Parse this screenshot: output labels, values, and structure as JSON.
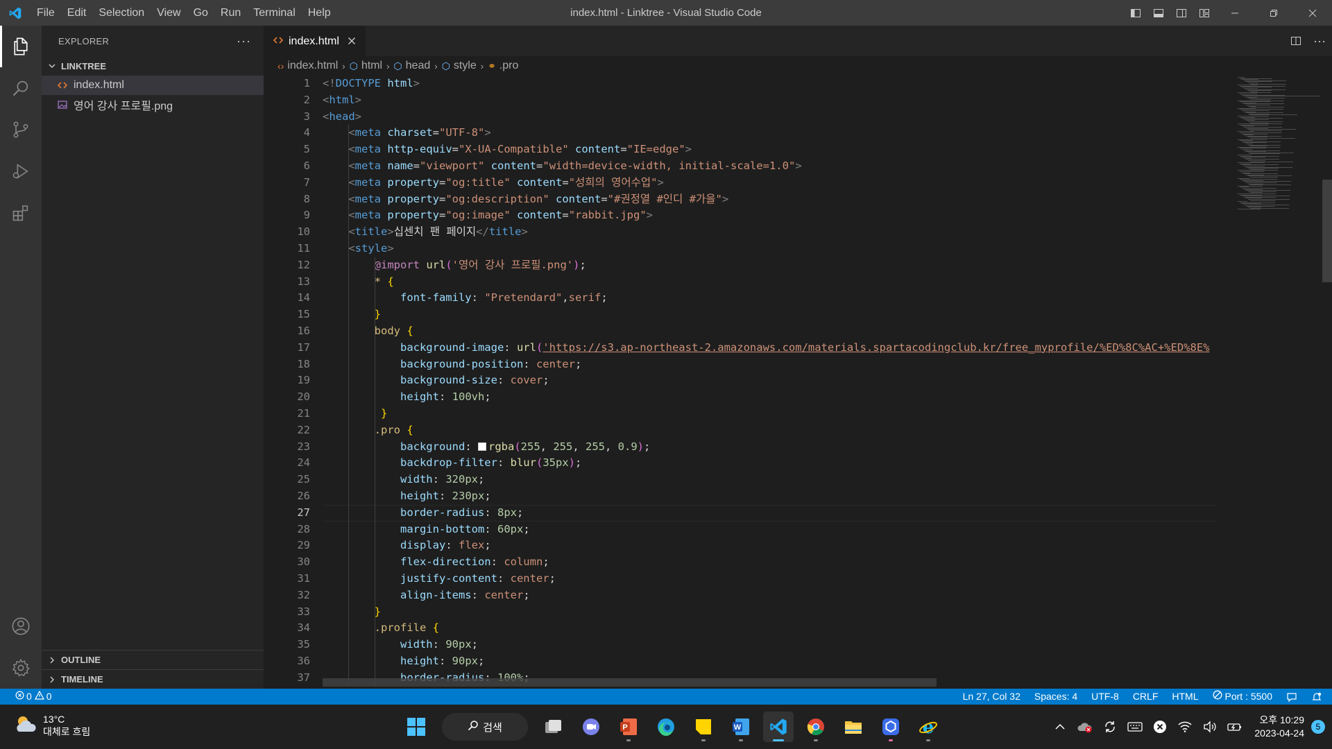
{
  "window": {
    "title": "index.html - Linktree - Visual Studio Code",
    "menu": [
      "File",
      "Edit",
      "Selection",
      "View",
      "Go",
      "Run",
      "Terminal",
      "Help"
    ]
  },
  "sidebar": {
    "title": "EXPLORER",
    "folder": "LINKTREE",
    "files": [
      {
        "name": "index.html",
        "icon": "html-file-icon"
      },
      {
        "name": "영어 강사 프로필.png",
        "icon": "image-file-icon"
      }
    ],
    "outline": "OUTLINE",
    "timeline": "TIMELINE"
  },
  "editor": {
    "tab_label": "index.html",
    "breadcrumb": [
      "index.html",
      "html",
      "head",
      "style",
      ".pro"
    ],
    "current_line": 27,
    "line_numbers": [
      1,
      2,
      3,
      4,
      5,
      6,
      7,
      8,
      9,
      10,
      11,
      12,
      13,
      14,
      15,
      16,
      17,
      18,
      19,
      20,
      21,
      22,
      23,
      24,
      25,
      26,
      27,
      28,
      29,
      30,
      31,
      32,
      33,
      34,
      35,
      36,
      37
    ],
    "lines": [
      {
        "indent": 0,
        "tokens": [
          [
            "t-tag",
            "<!"
          ],
          [
            "t-name",
            "DOCTYPE "
          ],
          [
            "t-attr",
            "html"
          ],
          [
            "t-tag",
            ">"
          ]
        ]
      },
      {
        "indent": 0,
        "tokens": [
          [
            "t-tag",
            "<"
          ],
          [
            "t-name",
            "html"
          ],
          [
            "t-tag",
            ">"
          ]
        ]
      },
      {
        "indent": 0,
        "tokens": [
          [
            "t-tag",
            "<"
          ],
          [
            "t-name",
            "head"
          ],
          [
            "t-tag",
            ">"
          ]
        ]
      },
      {
        "indent": 1,
        "tokens": [
          [
            "t-tag",
            "<"
          ],
          [
            "t-name",
            "meta "
          ],
          [
            "t-attr",
            "charset"
          ],
          [
            "t-punct",
            "="
          ],
          [
            "t-str",
            "\"UTF-8\""
          ],
          [
            "t-tag",
            ">"
          ]
        ]
      },
      {
        "indent": 1,
        "tokens": [
          [
            "t-tag",
            "<"
          ],
          [
            "t-name",
            "meta "
          ],
          [
            "t-attr",
            "http-equiv"
          ],
          [
            "t-punct",
            "="
          ],
          [
            "t-str",
            "\"X-UA-Compatible\""
          ],
          [
            "t-punct",
            " "
          ],
          [
            "t-attr",
            "content"
          ],
          [
            "t-punct",
            "="
          ],
          [
            "t-str",
            "\"IE=edge\""
          ],
          [
            "t-tag",
            ">"
          ]
        ]
      },
      {
        "indent": 1,
        "tokens": [
          [
            "t-tag",
            "<"
          ],
          [
            "t-name",
            "meta "
          ],
          [
            "t-attr",
            "name"
          ],
          [
            "t-punct",
            "="
          ],
          [
            "t-str",
            "\"viewport\""
          ],
          [
            "t-punct",
            " "
          ],
          [
            "t-attr",
            "content"
          ],
          [
            "t-punct",
            "="
          ],
          [
            "t-str",
            "\"width=device-width, initial-scale=1.0\""
          ],
          [
            "t-tag",
            ">"
          ]
        ]
      },
      {
        "indent": 1,
        "tokens": [
          [
            "t-tag",
            "<"
          ],
          [
            "t-name",
            "meta "
          ],
          [
            "t-attr",
            "property"
          ],
          [
            "t-punct",
            "="
          ],
          [
            "t-str",
            "\"og:title\""
          ],
          [
            "t-punct",
            " "
          ],
          [
            "t-attr",
            "content"
          ],
          [
            "t-punct",
            "="
          ],
          [
            "t-str",
            "\"성희의 영어수업\""
          ],
          [
            "t-tag",
            ">"
          ]
        ]
      },
      {
        "indent": 1,
        "tokens": [
          [
            "t-tag",
            "<"
          ],
          [
            "t-name",
            "meta "
          ],
          [
            "t-attr",
            "property"
          ],
          [
            "t-punct",
            "="
          ],
          [
            "t-str",
            "\"og:description\""
          ],
          [
            "t-punct",
            " "
          ],
          [
            "t-attr",
            "content"
          ],
          [
            "t-punct",
            "="
          ],
          [
            "t-str",
            "\"#권정열 #인디 #가을\""
          ],
          [
            "t-tag",
            ">"
          ]
        ]
      },
      {
        "indent": 1,
        "tokens": [
          [
            "t-tag",
            "<"
          ],
          [
            "t-name",
            "meta "
          ],
          [
            "t-attr",
            "property"
          ],
          [
            "t-punct",
            "="
          ],
          [
            "t-str",
            "\"og:image\""
          ],
          [
            "t-punct",
            " "
          ],
          [
            "t-attr",
            "content"
          ],
          [
            "t-punct",
            "="
          ],
          [
            "t-str",
            "\"rabbit.jpg\""
          ],
          [
            "t-tag",
            ">"
          ]
        ]
      },
      {
        "indent": 1,
        "tokens": [
          [
            "t-tag",
            "<"
          ],
          [
            "t-name",
            "title"
          ],
          [
            "t-tag",
            ">"
          ],
          [
            "t-text",
            "십센치 팬 페이지"
          ],
          [
            "t-tag",
            "</"
          ],
          [
            "t-name",
            "title"
          ],
          [
            "t-tag",
            ">"
          ]
        ]
      },
      {
        "indent": 1,
        "tokens": [
          [
            "t-tag",
            "<"
          ],
          [
            "t-name",
            "style"
          ],
          [
            "t-tag",
            ">"
          ]
        ]
      },
      {
        "indent": 2,
        "tokens": [
          [
            "t-at",
            "@import "
          ],
          [
            "t-fn",
            "url"
          ],
          [
            "t-br2",
            "("
          ],
          [
            "t-str",
            "'영어 강사 프로필.png'"
          ],
          [
            "t-br2",
            ")"
          ],
          [
            "t-punct",
            ";"
          ]
        ]
      },
      {
        "indent": 2,
        "tokens": [
          [
            "t-sel",
            "* "
          ],
          [
            "t-br1",
            "{"
          ]
        ]
      },
      {
        "indent": 3,
        "tokens": [
          [
            "t-prop",
            "font-family"
          ],
          [
            "t-punct",
            ": "
          ],
          [
            "t-val",
            "\"Pretendard\""
          ],
          [
            "t-punct",
            ","
          ],
          [
            "t-val",
            "serif"
          ],
          [
            "t-punct",
            ";"
          ]
        ]
      },
      {
        "indent": 2,
        "tokens": [
          [
            "t-br1",
            "}"
          ]
        ]
      },
      {
        "indent": 2,
        "tokens": [
          [
            "t-sel",
            "body "
          ],
          [
            "t-br1",
            "{"
          ]
        ]
      },
      {
        "indent": 3,
        "tokens": [
          [
            "t-prop",
            "background-image"
          ],
          [
            "t-punct",
            ": "
          ],
          [
            "t-fn",
            "url"
          ],
          [
            "t-br2",
            "("
          ],
          [
            "t-url",
            "'https://s3.ap-northeast-2.amazonaws.com/materials.spartacodingclub.kr/free_myprofile/%ED%8C%AC+%ED%8E%"
          ]
        ]
      },
      {
        "indent": 3,
        "tokens": [
          [
            "t-prop",
            "background-position"
          ],
          [
            "t-punct",
            ": "
          ],
          [
            "t-val",
            "center"
          ],
          [
            "t-punct",
            ";"
          ]
        ]
      },
      {
        "indent": 3,
        "tokens": [
          [
            "t-prop",
            "background-size"
          ],
          [
            "t-punct",
            ": "
          ],
          [
            "t-val",
            "cover"
          ],
          [
            "t-punct",
            ";"
          ]
        ]
      },
      {
        "indent": 3,
        "tokens": [
          [
            "t-prop",
            "height"
          ],
          [
            "t-punct",
            ": "
          ],
          [
            "t-num",
            "100vh"
          ],
          [
            "t-punct",
            ";"
          ]
        ]
      },
      {
        "indent": 2,
        "tokens": [
          [
            "t-punct",
            " "
          ],
          [
            "t-br1",
            "}"
          ]
        ]
      },
      {
        "indent": 2,
        "tokens": [
          [
            "t-sel",
            ".pro "
          ],
          [
            "t-br1",
            "{"
          ]
        ]
      },
      {
        "indent": 3,
        "swatch": true,
        "tokens": [
          [
            "t-prop",
            "background"
          ],
          [
            "t-punct",
            ": "
          ],
          [
            "t-fn",
            "rgba"
          ],
          [
            "t-br2",
            "("
          ],
          [
            "t-num",
            "255"
          ],
          [
            "t-punct",
            ", "
          ],
          [
            "t-num",
            "255"
          ],
          [
            "t-punct",
            ", "
          ],
          [
            "t-num",
            "255"
          ],
          [
            "t-punct",
            ", "
          ],
          [
            "t-num",
            "0.9"
          ],
          [
            "t-br2",
            ")"
          ],
          [
            "t-punct",
            ";"
          ]
        ]
      },
      {
        "indent": 3,
        "tokens": [
          [
            "t-prop",
            "backdrop-filter"
          ],
          [
            "t-punct",
            ": "
          ],
          [
            "t-fn",
            "blur"
          ],
          [
            "t-br2",
            "("
          ],
          [
            "t-num",
            "35px"
          ],
          [
            "t-br2",
            ")"
          ],
          [
            "t-punct",
            ";"
          ]
        ]
      },
      {
        "indent": 3,
        "tokens": [
          [
            "t-prop",
            "width"
          ],
          [
            "t-punct",
            ": "
          ],
          [
            "t-num",
            "320px"
          ],
          [
            "t-punct",
            ";"
          ]
        ]
      },
      {
        "indent": 3,
        "tokens": [
          [
            "t-prop",
            "height"
          ],
          [
            "t-punct",
            ": "
          ],
          [
            "t-num",
            "230px"
          ],
          [
            "t-punct",
            ";"
          ]
        ]
      },
      {
        "indent": 3,
        "tokens": [
          [
            "t-prop",
            "border-radius"
          ],
          [
            "t-punct",
            ": "
          ],
          [
            "t-num",
            "8px"
          ],
          [
            "t-punct",
            ";"
          ]
        ]
      },
      {
        "indent": 3,
        "tokens": [
          [
            "t-prop",
            "margin-bottom"
          ],
          [
            "t-punct",
            ": "
          ],
          [
            "t-num",
            "60px"
          ],
          [
            "t-punct",
            ";"
          ]
        ]
      },
      {
        "indent": 3,
        "tokens": [
          [
            "t-prop",
            "display"
          ],
          [
            "t-punct",
            ": "
          ],
          [
            "t-val",
            "flex"
          ],
          [
            "t-punct",
            ";"
          ]
        ]
      },
      {
        "indent": 3,
        "tokens": [
          [
            "t-prop",
            "flex-direction"
          ],
          [
            "t-punct",
            ": "
          ],
          [
            "t-val",
            "column"
          ],
          [
            "t-punct",
            ";"
          ]
        ]
      },
      {
        "indent": 3,
        "tokens": [
          [
            "t-prop",
            "justify-content"
          ],
          [
            "t-punct",
            ": "
          ],
          [
            "t-val",
            "center"
          ],
          [
            "t-punct",
            ";"
          ]
        ]
      },
      {
        "indent": 3,
        "tokens": [
          [
            "t-prop",
            "align-items"
          ],
          [
            "t-punct",
            ": "
          ],
          [
            "t-val",
            "center"
          ],
          [
            "t-punct",
            ";"
          ]
        ]
      },
      {
        "indent": 2,
        "tokens": [
          [
            "t-br1",
            "}"
          ]
        ]
      },
      {
        "indent": 2,
        "tokens": [
          [
            "t-sel",
            ".profile "
          ],
          [
            "t-br1",
            "{"
          ]
        ]
      },
      {
        "indent": 3,
        "tokens": [
          [
            "t-prop",
            "width"
          ],
          [
            "t-punct",
            ": "
          ],
          [
            "t-num",
            "90px"
          ],
          [
            "t-punct",
            ";"
          ]
        ]
      },
      {
        "indent": 3,
        "tokens": [
          [
            "t-prop",
            "height"
          ],
          [
            "t-punct",
            ": "
          ],
          [
            "t-num",
            "90px"
          ],
          [
            "t-punct",
            ";"
          ]
        ]
      },
      {
        "indent": 3,
        "tokens": [
          [
            "t-prop",
            "border-radius"
          ],
          [
            "t-punct",
            ": "
          ],
          [
            "t-num",
            "100%"
          ],
          [
            "t-punct",
            ";"
          ]
        ]
      }
    ]
  },
  "statusbar": {
    "errors": "0",
    "warnings": "0",
    "position": "Ln 27, Col 32",
    "spaces": "Spaces: 4",
    "encoding": "UTF-8",
    "eol": "CRLF",
    "language": "HTML",
    "port": "Port : 5500"
  },
  "taskbar": {
    "weather_temp": "13°C",
    "weather_desc": "대체로 흐림",
    "search_label": "검색",
    "time": "오후 10:29",
    "date": "2023-04-24",
    "notification_count": "5"
  },
  "colors": {
    "accent": "#007acc",
    "titlebar": "#3c3c3c",
    "editor_bg": "#1e1e1e",
    "sidebar_bg": "#252526",
    "activitybar_bg": "#333333",
    "taskbar_bg": "#202020"
  }
}
